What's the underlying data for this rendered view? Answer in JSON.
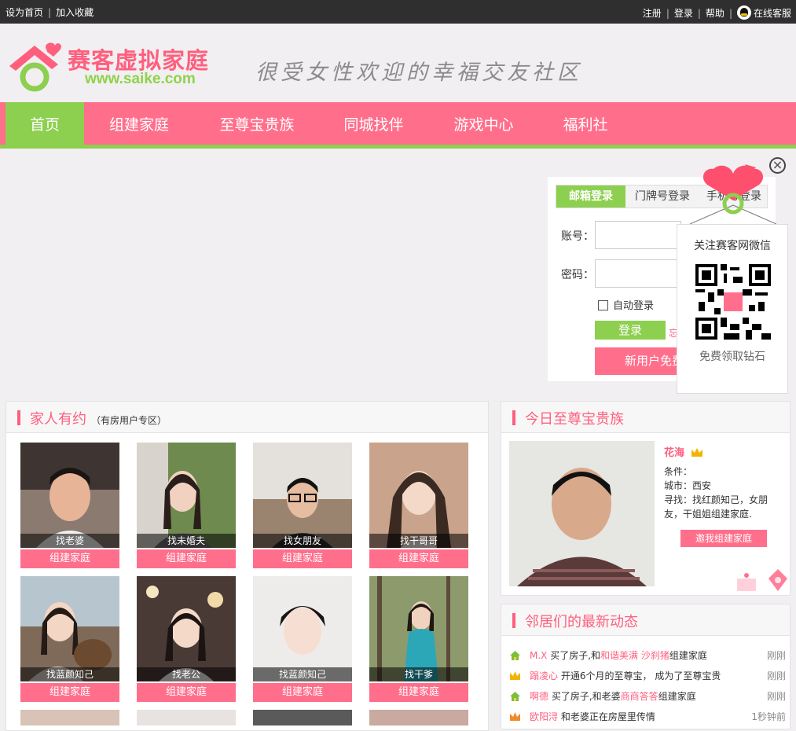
{
  "topbar": {
    "set_home": "设为首页",
    "bookmark": "加入收藏",
    "register": "注册",
    "login": "登录",
    "help": "帮助",
    "online_service": "在线客服"
  },
  "header": {
    "brand": "赛客虚拟家庭",
    "url": "www.saike.com",
    "slogan": "很受女性欢迎的幸福交友社区"
  },
  "nav": {
    "items": [
      "首页",
      "组建家庭",
      "至尊宝贵族",
      "同城找伴",
      "游戏中心",
      "福利社"
    ],
    "active_index": 0
  },
  "login": {
    "tabs": [
      "邮箱登录",
      "门牌号登录",
      "手机号登录"
    ],
    "account_label": "账号：",
    "password_label": "密码：",
    "auto_login": "自动登录",
    "login_button": "登录",
    "forgot": "忘",
    "register_button": "新用户免费注册"
  },
  "wechat": {
    "title": "关注赛客网微信",
    "subtitle": "免费领取钻石"
  },
  "family": {
    "title": "家人有约",
    "subtitle": "（有房用户专区）",
    "button_label": "组建家庭",
    "cards": [
      {
        "caption": "找老婆"
      },
      {
        "caption": "找未婚夫"
      },
      {
        "caption": "找女朋友"
      },
      {
        "caption": "找干哥哥"
      },
      {
        "caption": "找蓝颜知己"
      },
      {
        "caption": "找老公"
      },
      {
        "caption": "找蓝颜知己"
      },
      {
        "caption": "找干爹"
      }
    ]
  },
  "vip": {
    "title": "今日至尊宝贵族",
    "name": "花海",
    "condition_label": "条件：",
    "city": "城市：西安",
    "seeking": "寻找：找红颜知己，女朋友，干姐姐组建家庭.",
    "button": "邀我组建家庭"
  },
  "feed": {
    "title": "邻居们的最新动态",
    "rows": [
      {
        "icon": "house-icon",
        "user": "M.X",
        "pre": "买了房子,和",
        "target": "和谐美满 沙刹猪",
        "post": "组建家庭",
        "time": "刚刚"
      },
      {
        "icon": "crown-icon",
        "user": "蹋凌心",
        "pre": "开通6个月的至尊宝，",
        "target": "",
        "post": "成为了至尊宝贵",
        "time": "刚刚"
      },
      {
        "icon": "house-icon",
        "user": "啊德",
        "pre": "买了房子,和老婆",
        "target": "商商答答",
        "post": "组建家庭",
        "time": "刚刚"
      },
      {
        "icon": "crown-icon",
        "user": "欧阳浔",
        "pre": "和老婆正在房屋里传情",
        "target": "",
        "post": "",
        "time": "1秒钟前"
      }
    ]
  },
  "colors": {
    "pink": "#ff6f8c",
    "green": "#8dcf4f",
    "dark": "#2f2f2f"
  }
}
